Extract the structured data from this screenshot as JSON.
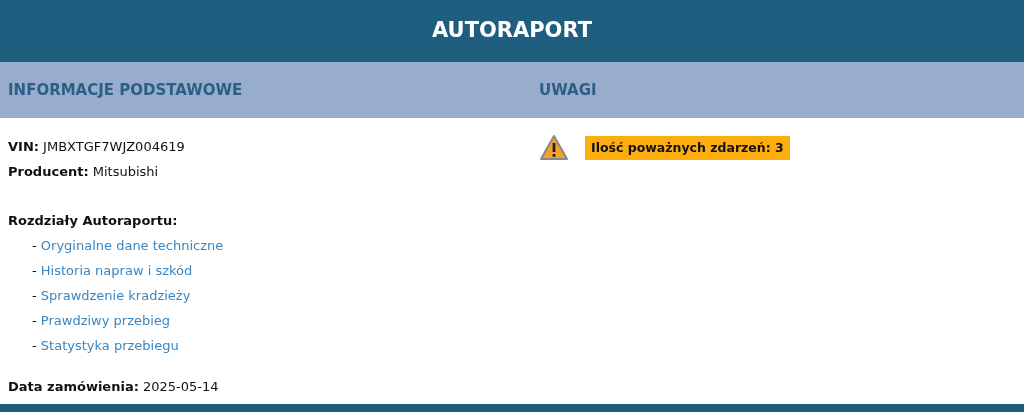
{
  "title": "AUTORAPORT",
  "basic": {
    "heading": "INFORMACJE PODSTAWOWE",
    "fields": [
      {
        "label": "VIN:",
        "value": "JMBXTGF7WJZ004619"
      },
      {
        "label": "Producent:",
        "value": "Mitsubishi"
      }
    ],
    "sections_heading": "Rozdziały Autoraportu:",
    "sections": [
      {
        "bullet": "-",
        "label": "Oryginalne dane techniczne"
      },
      {
        "bullet": "-",
        "label": "Historia napraw i szkód"
      },
      {
        "bullet": "-",
        "label": "Sprawdzenie kradzieży"
      },
      {
        "bullet": "-",
        "label": "Prawdziwy przebieg"
      },
      {
        "bullet": "-",
        "label": "Statystyka przebiegu"
      }
    ],
    "order_date": {
      "label": "Data zamówienia:",
      "value": "2025-05-14"
    }
  },
  "notes": {
    "heading": "UWAGI",
    "alerts": [
      {
        "text": "Ilość poważnych zdarzeń: 3"
      }
    ]
  }
}
